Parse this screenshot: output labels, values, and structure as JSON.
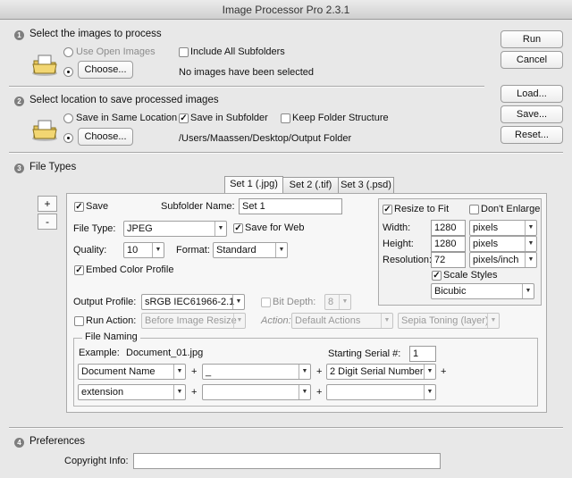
{
  "window": {
    "title": "Image Processor Pro 2.3.1"
  },
  "section1": {
    "num": "1",
    "title": "Select the images to process",
    "use_open_images": "Use Open Images",
    "include_subfolders": "Include All Subfolders",
    "choose": "Choose...",
    "status": "No images have been selected"
  },
  "section2": {
    "num": "2",
    "title": "Select location to save processed images",
    "save_same": "Save in Same Location",
    "save_subfolder": "Save in Subfolder",
    "keep_structure": "Keep Folder Structure",
    "choose": "Choose...",
    "path": "/Users/Maassen/Desktop/Output Folder"
  },
  "section3": {
    "num": "3",
    "title": "File Types",
    "add": "+",
    "remove": "-",
    "tabs": [
      "Set 1 (.jpg)",
      "Set 2 (.tif)",
      "Set 3 (.psd)"
    ],
    "save": "Save",
    "subfolder_label": "Subfolder Name:",
    "subfolder_value": "Set 1",
    "file_type_label": "File Type:",
    "file_type_value": "JPEG",
    "save_for_web": "Save for Web",
    "quality_label": "Quality:",
    "quality_value": "10",
    "format_label": "Format:",
    "format_value": "Standard",
    "embed_profile": "Embed Color Profile",
    "resize": {
      "resize_to_fit": "Resize to Fit",
      "dont_enlarge": "Don't Enlarge",
      "width_label": "Width:",
      "width_value": "1280",
      "width_unit": "pixels",
      "height_label": "Height:",
      "height_value": "1280",
      "height_unit": "pixels",
      "resolution_label": "Resolution:",
      "resolution_value": "72",
      "resolution_unit": "pixels/inch",
      "scale_styles": "Scale Styles",
      "interpolation": "Bicubic"
    },
    "output_profile_label": "Output Profile:",
    "output_profile_value": "sRGB IEC61966-2.1",
    "bit_depth_label": "Bit Depth:",
    "bit_depth_value": "8",
    "run_action": "Run Action:",
    "action_when": "Before Image Resize",
    "action_label": "Action:",
    "action_set": "Default Actions",
    "action_name": "Sepia Toning (layer)",
    "naming": {
      "legend": "File Naming",
      "example_label": "Example:",
      "example_value": "Document_01.jpg",
      "serial_label": "Starting Serial #:",
      "serial_value": "1",
      "row1": [
        "Document Name",
        "_",
        "2 Digit Serial Number"
      ],
      "row2": [
        "extension",
        "",
        ""
      ],
      "plus": "+"
    }
  },
  "section4": {
    "num": "4",
    "title": "Preferences",
    "copyright_label": "Copyright Info:",
    "copyright_value": ""
  },
  "buttons": {
    "run": "Run",
    "cancel": "Cancel",
    "load": "Load...",
    "save": "Save...",
    "reset": "Reset..."
  },
  "checks": {
    "mark": "✓",
    "arrow": "▼"
  }
}
